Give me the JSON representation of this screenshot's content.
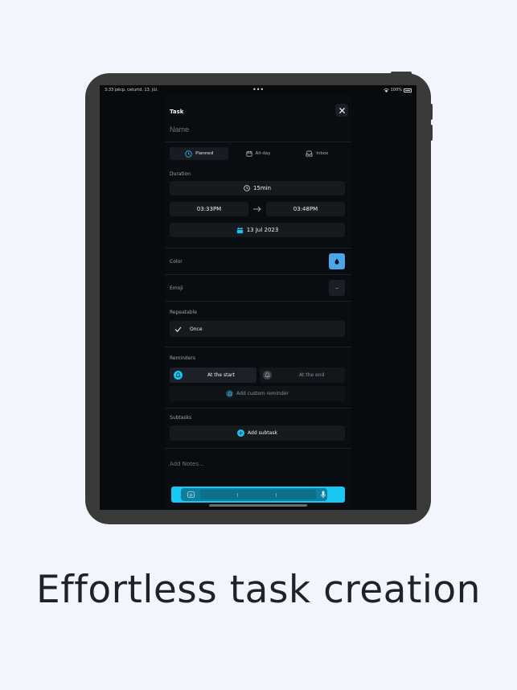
{
  "status_bar": {
    "time_date": "3:33 pēcp.  ceturtd. 13. jūl.",
    "dots": "•••",
    "battery": "100%"
  },
  "sheet": {
    "title": "Task",
    "name_placeholder": "Name",
    "tabs": [
      {
        "label": "Planned",
        "icon": "clock-icon",
        "active": true
      },
      {
        "label": "All-day",
        "icon": "calendar-icon",
        "active": false
      },
      {
        "label": "Inbox",
        "icon": "inbox-icon",
        "active": false
      }
    ],
    "duration": {
      "label": "Duration",
      "value": "15min",
      "start": "03:33PM",
      "end": "03:48PM",
      "date": "13 Jul 2023"
    },
    "color": {
      "label": "Color",
      "swatch": "#4aa6e6",
      "icon": "drop-icon"
    },
    "emoji": {
      "label": "Emoji",
      "value": "–"
    },
    "repeatable": {
      "label": "Repeatable",
      "value": "Once"
    },
    "reminders": {
      "label": "Reminders",
      "start": "At the start",
      "end": "At the end",
      "add_custom": "Add custom reminder"
    },
    "subtasks": {
      "label": "Subtasks",
      "add": "Add subtask"
    },
    "notes_placeholder": "Add Notes...",
    "accent": "#19c7f4"
  },
  "headline": "Effortless task creation"
}
